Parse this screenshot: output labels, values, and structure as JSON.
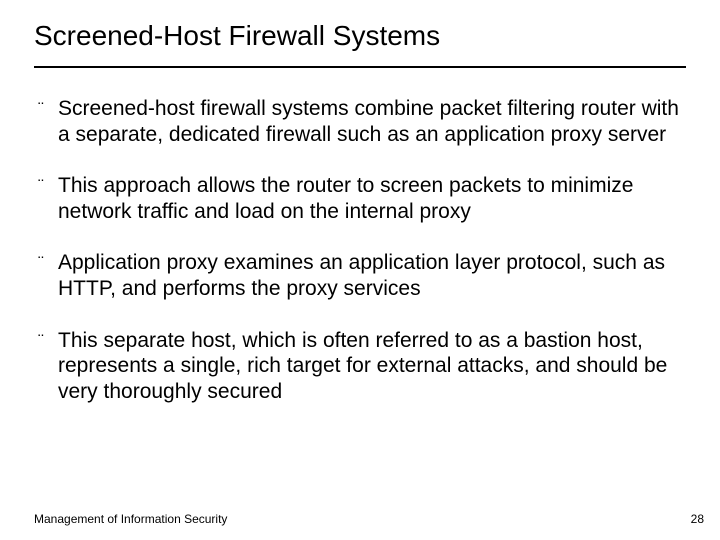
{
  "title": "Screened-Host Firewall Systems",
  "bullets": [
    "Screened-host firewall systems combine packet filtering router with a separate, dedicated firewall such as an application proxy server",
    "This approach allows the router to screen packets to minimize network traffic and load on the internal proxy",
    "Application proxy examines an application layer protocol, such as HTTP, and performs the proxy services",
    "This separate host, which is often referred to as a bastion host, represents a single, rich target for external attacks, and should be very thoroughly secured"
  ],
  "footer": "Management of Information Security",
  "page": "28",
  "bullet_glyph": "¨"
}
